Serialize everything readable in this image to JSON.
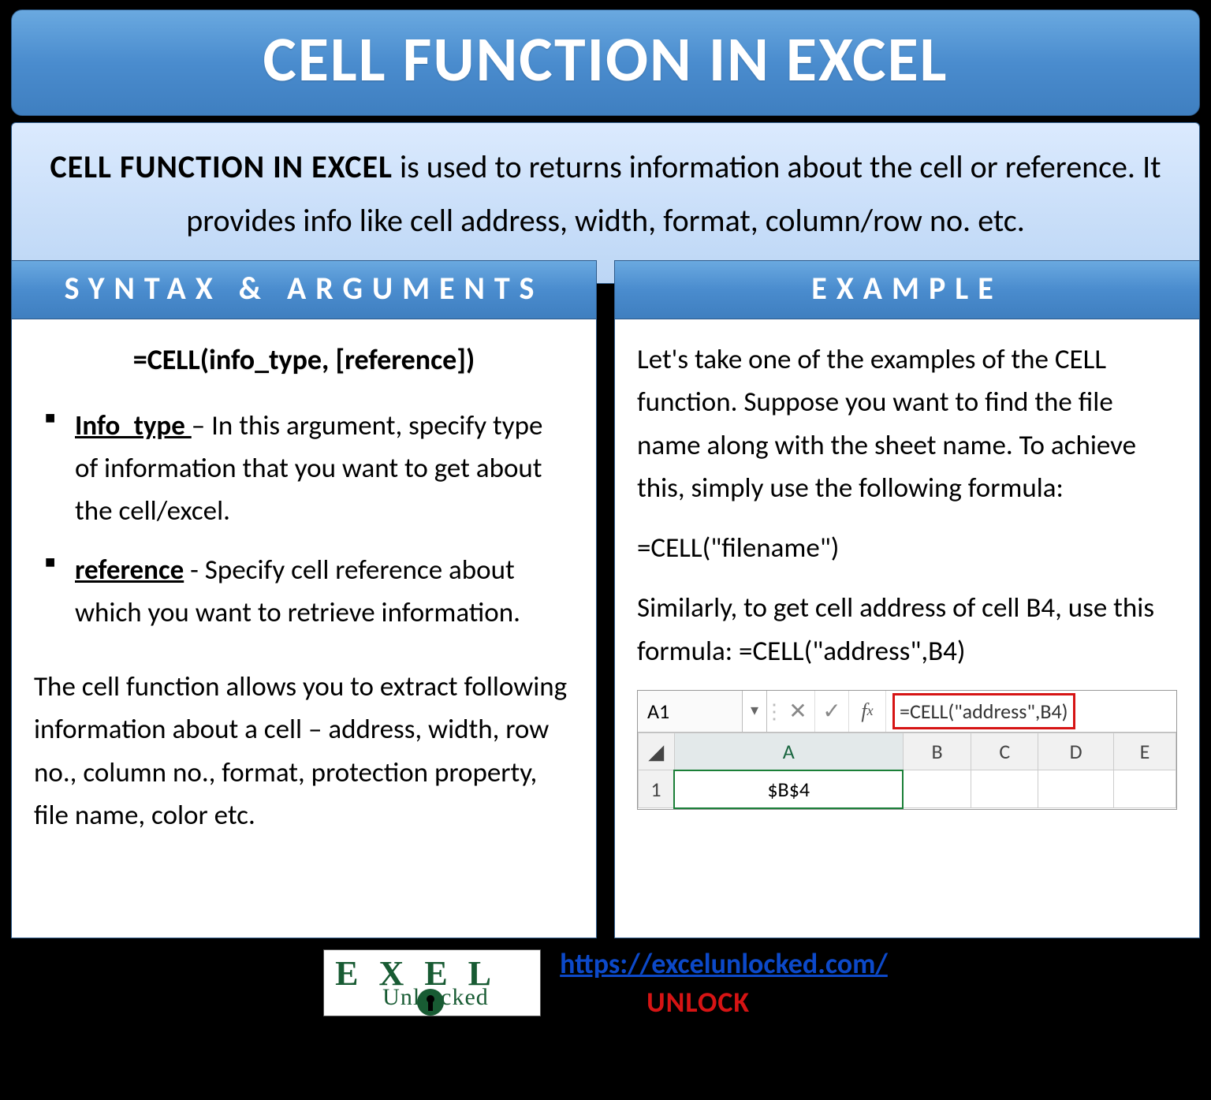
{
  "title": "CELL FUNCTION IN EXCEL",
  "intro": {
    "bold": "CELL FUNCTION IN EXCEL",
    "rest": " is used to returns information about the cell or reference. It provides info like cell address, width, format, column/row no. etc."
  },
  "left": {
    "heading": "SYNTAX & ARGUMENTS",
    "syntax": "=CELL(info_type, [reference])",
    "args": [
      {
        "name": "Info_type ",
        "desc": "– In this argument, specify type of information that you want to get about the cell/excel."
      },
      {
        "name": "reference",
        "desc": " - Specify cell reference about which you want to retrieve information."
      }
    ],
    "summary": "The cell function allows you to extract following information about a cell – address, width, row no., column no., format, protection property, file name, color etc."
  },
  "right": {
    "heading": "EXAMPLE",
    "p1": "Let's take one of the examples of the CELL function. Suppose you want to find the file name along with the sheet name. To achieve this, simply use the following formula:",
    "formula1": "=CELL(\"filename\")",
    "p2": "Similarly, to get cell address of cell B4, use this formula: =CELL(\"address\",B4)",
    "excel": {
      "active_cell": "A1",
      "formula": "=CELL(\"address\",B4)",
      "columns": [
        "A",
        "B",
        "C",
        "D",
        "E"
      ],
      "row1": "1",
      "a1_value": "$B$4"
    }
  },
  "footer": {
    "url": "https://excelunlocked.com/",
    "tagline": "UNLOCK",
    "logo_top": "EX   EL",
    "logo_bottom_left": "Unl",
    "logo_bottom_right": "cked"
  }
}
